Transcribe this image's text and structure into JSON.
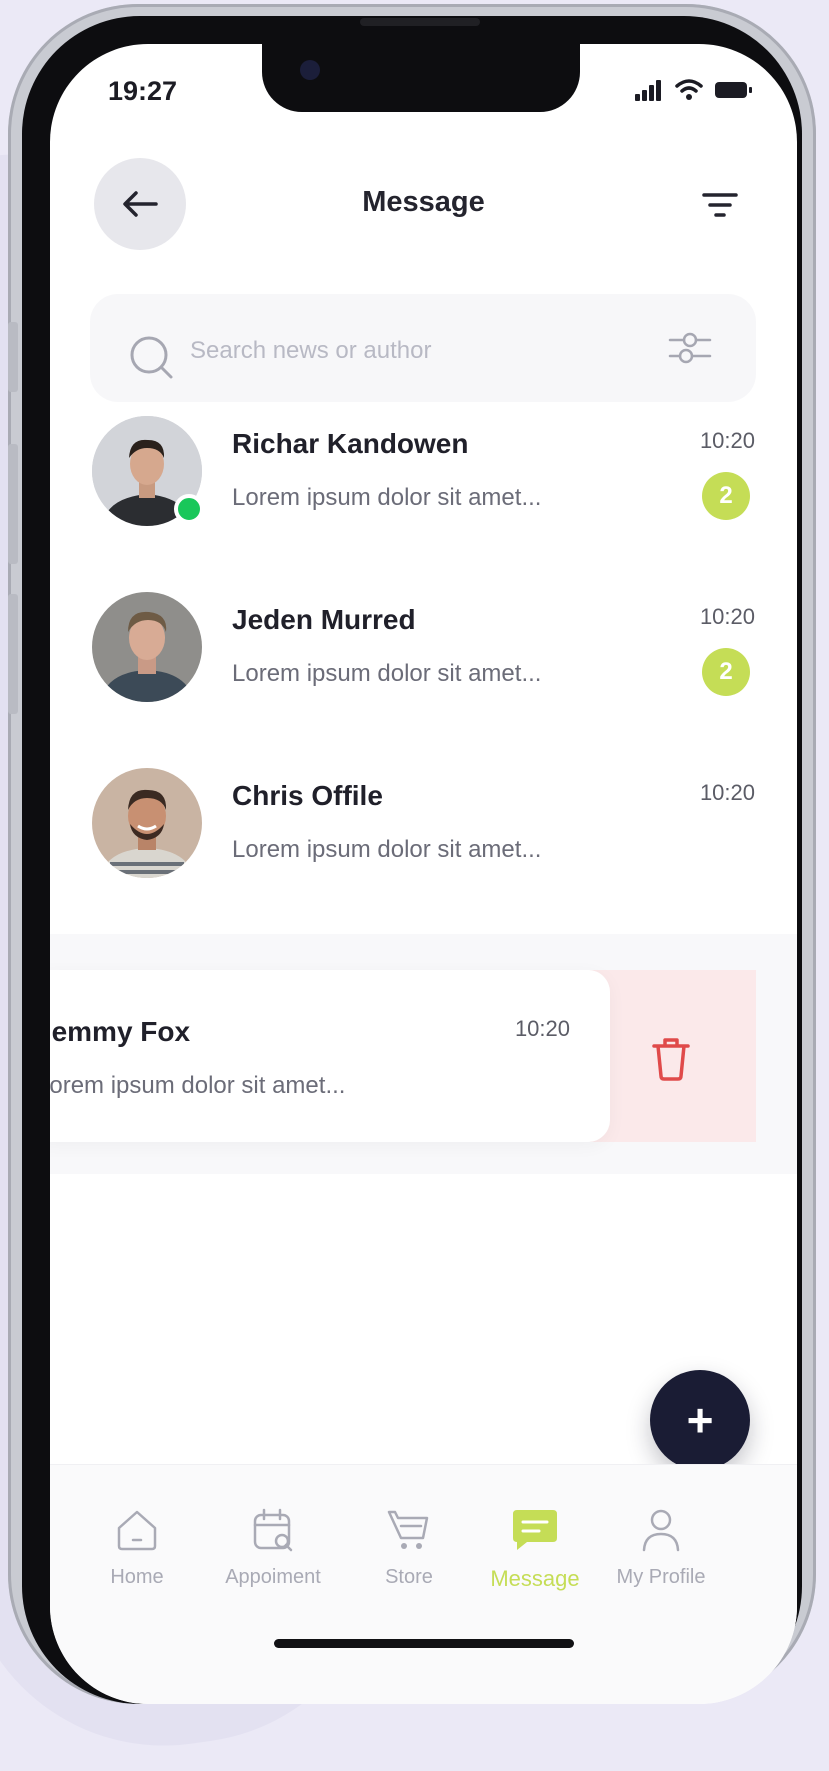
{
  "status_bar": {
    "time": "19:27"
  },
  "header": {
    "title": "Message"
  },
  "search": {
    "placeholder": "Search news or author"
  },
  "chats": [
    {
      "name": "Richar Kandowen",
      "preview": "Lorem ipsum dolor sit amet...",
      "time": "10:20",
      "unread": "2",
      "online": true
    },
    {
      "name": "Jeden Murred",
      "preview": "Lorem ipsum dolor sit amet...",
      "time": "10:20",
      "unread": "2",
      "online": false
    },
    {
      "name": "Chris Offile",
      "preview": "Lorem ipsum dolor sit amet...",
      "time": "10:20",
      "unread": "",
      "online": false
    }
  ],
  "swiped_chat": {
    "name": "Jemmy Fox",
    "preview": "Lorem ipsum dolor sit amet...",
    "time": "10:20"
  },
  "tabs": [
    {
      "label": "Home",
      "icon": "home-icon",
      "active": false
    },
    {
      "label": "Appoiment",
      "icon": "calendar-icon",
      "active": false
    },
    {
      "label": "Store",
      "icon": "cart-icon",
      "active": false
    },
    {
      "label": "Message",
      "icon": "message-icon",
      "active": true
    },
    {
      "label": "My Profile",
      "icon": "profile-icon",
      "active": false
    }
  ],
  "colors": {
    "accent": "#c5dd56",
    "fab": "#1a1c34",
    "online": "#19c75a",
    "delete": "#e04a4a",
    "delete_bg": "#fbe9ea"
  }
}
